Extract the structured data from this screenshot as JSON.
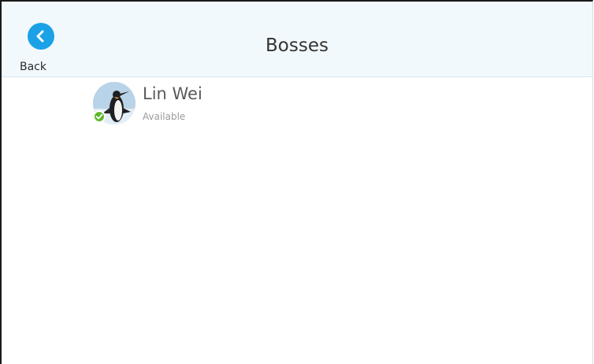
{
  "header": {
    "back_label": "Back",
    "title": "Bosses"
  },
  "contacts": [
    {
      "name": "Lin Wei",
      "status": "Available",
      "avatar_icon": "penguin-avatar",
      "status_icon": "available-check-icon"
    }
  ],
  "colors": {
    "header_bg": "#f2f9fc",
    "accent": "#1aa1e6",
    "available": "#5cb82c"
  }
}
